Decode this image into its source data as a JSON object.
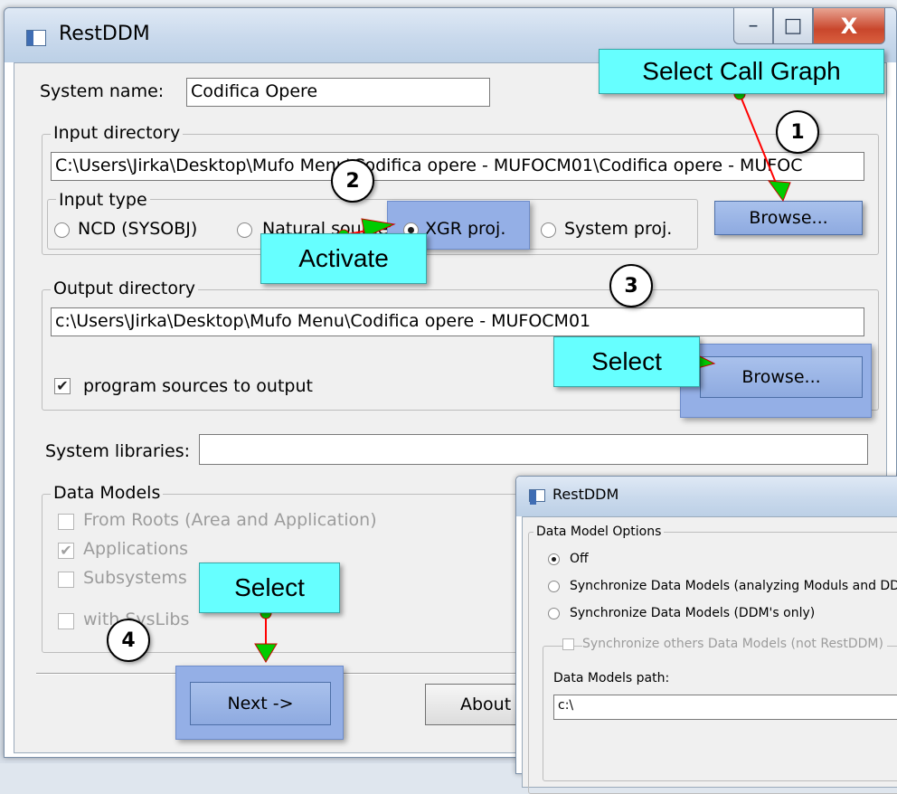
{
  "window": {
    "title": "RestDDM"
  },
  "system_name": {
    "label": "System name:",
    "value": "Codifica Opere"
  },
  "input_directory": {
    "group_label": "Input directory",
    "path": "C:\\Users\\Jirka\\Desktop\\Mufo Menu\\Codifica opere - MUFOCM01\\Codifica  opere - MUFOC",
    "browse_label": "Browse..."
  },
  "input_type": {
    "group_label": "Input type",
    "options": [
      "NCD (SYSOBJ)",
      "Natural sources",
      "XGR proj.",
      "System proj."
    ],
    "selected": "XGR proj."
  },
  "output_directory": {
    "group_label": "Output directory",
    "path": "c:\\Users\\Jirka\\Desktop\\Mufo Menu\\Codifica opere - MUFOCM01",
    "checkbox_label": "program sources to output",
    "checkbox_checked": true,
    "browse_label": "Browse..."
  },
  "system_libraries": {
    "label": "System libraries:",
    "value": ""
  },
  "data_models": {
    "group_label": "Data Models",
    "items": [
      {
        "label": "From Roots (Area and Application)",
        "checked": false
      },
      {
        "label": "Applications",
        "checked": true
      },
      {
        "label": "Subsystems",
        "checked": false
      },
      {
        "label": "with SysLibs",
        "checked": false
      }
    ]
  },
  "buttons": {
    "next": "Next ->",
    "about": "About"
  },
  "annotations": {
    "select_call_graph": "Select Call Graph",
    "activate": "Activate",
    "select_output": "Select",
    "select_next": "Select",
    "steps": [
      "1",
      "2",
      "3",
      "4"
    ]
  },
  "dialog2": {
    "title": "RestDDM",
    "group_label": "Data Model Options",
    "options": [
      "Off",
      "Synchronize Data Models (analyzing Moduls and DDM's)",
      "Synchronize Data Models (DDM's only)"
    ],
    "selected": "Off",
    "sync_others_label": "Synchronize others Data Models (not RestDDM)",
    "path_label": "Data Models path:",
    "path_value": "c:\\"
  },
  "colors": {
    "callout": "#66ffff",
    "highlight": "#94afe6",
    "arrow": "#ff0000",
    "arrow_head": "#00cc00"
  }
}
